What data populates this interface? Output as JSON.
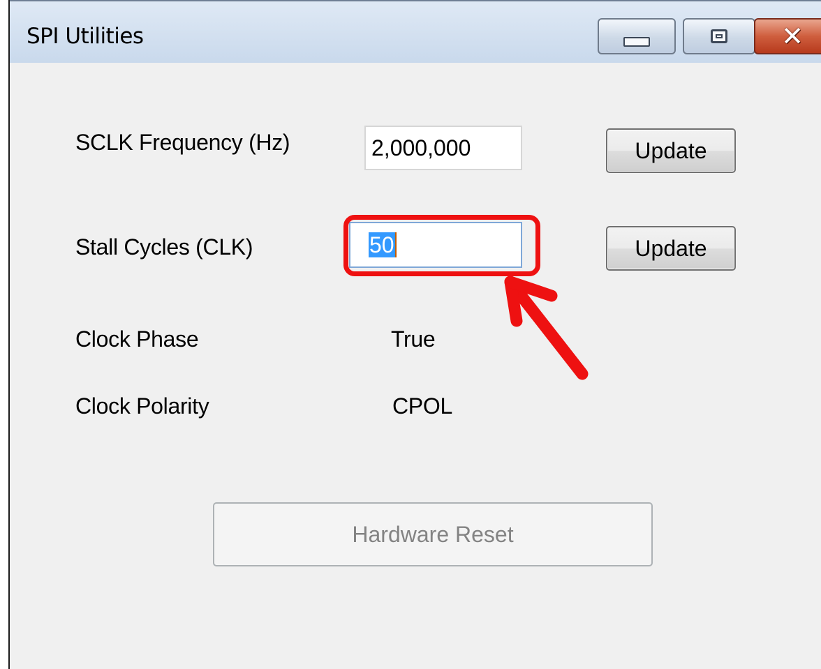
{
  "window": {
    "title": "SPI Utilities",
    "controls": {
      "minimize": "minimize-icon",
      "maximize": "maximize-icon",
      "close": "close-icon"
    }
  },
  "form": {
    "sclk_label": "SCLK Frequency (Hz)",
    "sclk_value": "2,000,000",
    "sclk_update": "Update",
    "stall_label": "Stall Cycles (CLK)",
    "stall_value": "50",
    "stall_update": "Update",
    "phase_label": "Clock Phase",
    "phase_value": "True",
    "polarity_label": "Clock Polarity",
    "polarity_value": "CPOL",
    "reset_button": "Hardware Reset"
  },
  "annotation": {
    "color": "#ee1111"
  }
}
